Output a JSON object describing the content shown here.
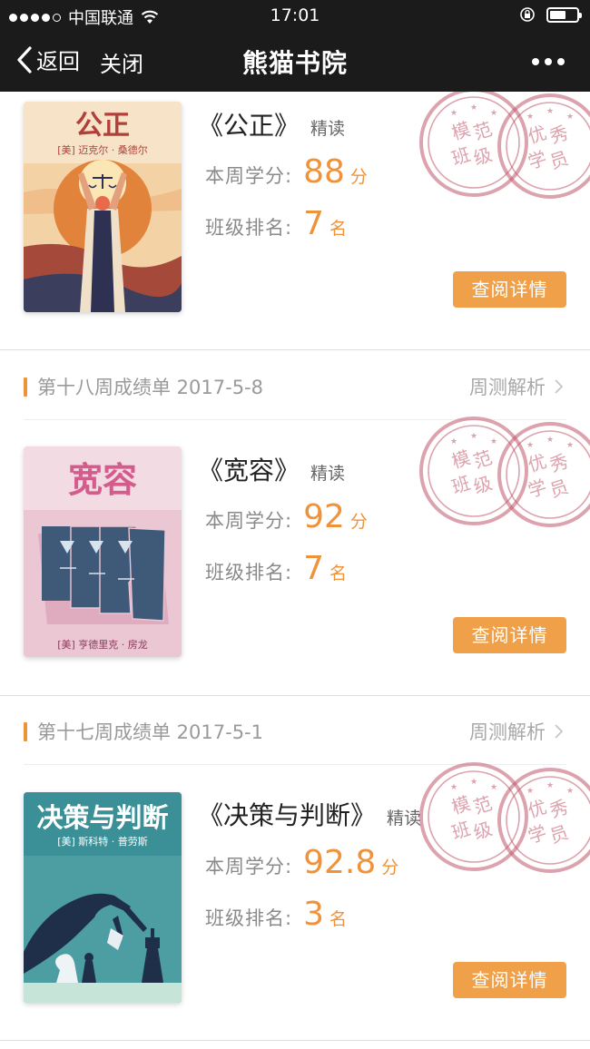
{
  "status_bar": {
    "carrier": "中国联通",
    "time": "17:01"
  },
  "nav": {
    "back_label": "返回",
    "close_label": "关闭",
    "title": "熊猫书院"
  },
  "cards": [
    {
      "week_title": "",
      "cover_title": "公正",
      "cover_author": "[美] 迈克尔 · 桑德尔",
      "book_title": "《公正》",
      "tag": "精读",
      "score_label": "本周学分:",
      "score": "88",
      "score_unit": "分",
      "rank_label": "班级排名:",
      "rank": "7",
      "rank_unit": "名",
      "button_label": "查阅详情"
    },
    {
      "week_title": "第十八周成绩单  2017-5-8",
      "week_link": "周测解析",
      "cover_title": "宽容",
      "cover_author": "[美] 亨德里克 · 房龙",
      "book_title": "《宽容》",
      "tag": "精读",
      "score_label": "本周学分:",
      "score": "92",
      "score_unit": "分",
      "rank_label": "班级排名:",
      "rank": "7",
      "rank_unit": "名",
      "button_label": "查阅详情"
    },
    {
      "week_title": "第十七周成绩单  2017-5-1",
      "week_link": "周测解析",
      "cover_title": "决策与判断",
      "cover_author": "[美] 斯科特 · 普劳斯",
      "book_title": "《决策与判断》",
      "tag": "精读",
      "score_label": "本周学分:",
      "score": "92.8",
      "score_unit": "分",
      "rank_label": "班级排名:",
      "rank": "3",
      "rank_unit": "名",
      "button_label": "查阅详情"
    }
  ],
  "stamps": {
    "stamp1": "模范班级",
    "stamp2": "优秀学员"
  },
  "colors": {
    "accent": "#f0923a",
    "button": "#f0a048",
    "stamp": "#c0586c",
    "navbar": "#1b1b1b"
  },
  "icons": [
    "chevron-left-icon",
    "more-icon",
    "wifi-icon",
    "lock-rotation-icon",
    "battery-icon",
    "chevron-right-icon",
    "stamp-icon"
  ]
}
